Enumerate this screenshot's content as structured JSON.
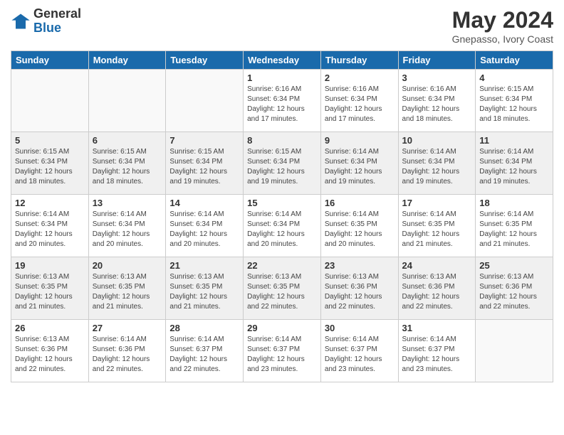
{
  "header": {
    "logo_general": "General",
    "logo_blue": "Blue",
    "title": "May 2024",
    "subtitle": "Gnepasso, Ivory Coast"
  },
  "columns": [
    "Sunday",
    "Monday",
    "Tuesday",
    "Wednesday",
    "Thursday",
    "Friday",
    "Saturday"
  ],
  "weeks": [
    {
      "days": [
        {
          "num": "",
          "info": ""
        },
        {
          "num": "",
          "info": ""
        },
        {
          "num": "",
          "info": ""
        },
        {
          "num": "1",
          "info": "Sunrise: 6:16 AM\nSunset: 6:34 PM\nDaylight: 12 hours and 17 minutes."
        },
        {
          "num": "2",
          "info": "Sunrise: 6:16 AM\nSunset: 6:34 PM\nDaylight: 12 hours and 17 minutes."
        },
        {
          "num": "3",
          "info": "Sunrise: 6:16 AM\nSunset: 6:34 PM\nDaylight: 12 hours and 18 minutes."
        },
        {
          "num": "4",
          "info": "Sunrise: 6:15 AM\nSunset: 6:34 PM\nDaylight: 12 hours and 18 minutes."
        }
      ]
    },
    {
      "days": [
        {
          "num": "5",
          "info": "Sunrise: 6:15 AM\nSunset: 6:34 PM\nDaylight: 12 hours and 18 minutes."
        },
        {
          "num": "6",
          "info": "Sunrise: 6:15 AM\nSunset: 6:34 PM\nDaylight: 12 hours and 18 minutes."
        },
        {
          "num": "7",
          "info": "Sunrise: 6:15 AM\nSunset: 6:34 PM\nDaylight: 12 hours and 19 minutes."
        },
        {
          "num": "8",
          "info": "Sunrise: 6:15 AM\nSunset: 6:34 PM\nDaylight: 12 hours and 19 minutes."
        },
        {
          "num": "9",
          "info": "Sunrise: 6:14 AM\nSunset: 6:34 PM\nDaylight: 12 hours and 19 minutes."
        },
        {
          "num": "10",
          "info": "Sunrise: 6:14 AM\nSunset: 6:34 PM\nDaylight: 12 hours and 19 minutes."
        },
        {
          "num": "11",
          "info": "Sunrise: 6:14 AM\nSunset: 6:34 PM\nDaylight: 12 hours and 19 minutes."
        }
      ]
    },
    {
      "days": [
        {
          "num": "12",
          "info": "Sunrise: 6:14 AM\nSunset: 6:34 PM\nDaylight: 12 hours and 20 minutes."
        },
        {
          "num": "13",
          "info": "Sunrise: 6:14 AM\nSunset: 6:34 PM\nDaylight: 12 hours and 20 minutes."
        },
        {
          "num": "14",
          "info": "Sunrise: 6:14 AM\nSunset: 6:34 PM\nDaylight: 12 hours and 20 minutes."
        },
        {
          "num": "15",
          "info": "Sunrise: 6:14 AM\nSunset: 6:34 PM\nDaylight: 12 hours and 20 minutes."
        },
        {
          "num": "16",
          "info": "Sunrise: 6:14 AM\nSunset: 6:35 PM\nDaylight: 12 hours and 20 minutes."
        },
        {
          "num": "17",
          "info": "Sunrise: 6:14 AM\nSunset: 6:35 PM\nDaylight: 12 hours and 21 minutes."
        },
        {
          "num": "18",
          "info": "Sunrise: 6:14 AM\nSunset: 6:35 PM\nDaylight: 12 hours and 21 minutes."
        }
      ]
    },
    {
      "days": [
        {
          "num": "19",
          "info": "Sunrise: 6:13 AM\nSunset: 6:35 PM\nDaylight: 12 hours and 21 minutes."
        },
        {
          "num": "20",
          "info": "Sunrise: 6:13 AM\nSunset: 6:35 PM\nDaylight: 12 hours and 21 minutes."
        },
        {
          "num": "21",
          "info": "Sunrise: 6:13 AM\nSunset: 6:35 PM\nDaylight: 12 hours and 21 minutes."
        },
        {
          "num": "22",
          "info": "Sunrise: 6:13 AM\nSunset: 6:35 PM\nDaylight: 12 hours and 22 minutes."
        },
        {
          "num": "23",
          "info": "Sunrise: 6:13 AM\nSunset: 6:36 PM\nDaylight: 12 hours and 22 minutes."
        },
        {
          "num": "24",
          "info": "Sunrise: 6:13 AM\nSunset: 6:36 PM\nDaylight: 12 hours and 22 minutes."
        },
        {
          "num": "25",
          "info": "Sunrise: 6:13 AM\nSunset: 6:36 PM\nDaylight: 12 hours and 22 minutes."
        }
      ]
    },
    {
      "days": [
        {
          "num": "26",
          "info": "Sunrise: 6:13 AM\nSunset: 6:36 PM\nDaylight: 12 hours and 22 minutes."
        },
        {
          "num": "27",
          "info": "Sunrise: 6:14 AM\nSunset: 6:36 PM\nDaylight: 12 hours and 22 minutes."
        },
        {
          "num": "28",
          "info": "Sunrise: 6:14 AM\nSunset: 6:37 PM\nDaylight: 12 hours and 22 minutes."
        },
        {
          "num": "29",
          "info": "Sunrise: 6:14 AM\nSunset: 6:37 PM\nDaylight: 12 hours and 23 minutes."
        },
        {
          "num": "30",
          "info": "Sunrise: 6:14 AM\nSunset: 6:37 PM\nDaylight: 12 hours and 23 minutes."
        },
        {
          "num": "31",
          "info": "Sunrise: 6:14 AM\nSunset: 6:37 PM\nDaylight: 12 hours and 23 minutes."
        },
        {
          "num": "",
          "info": ""
        }
      ]
    }
  ]
}
